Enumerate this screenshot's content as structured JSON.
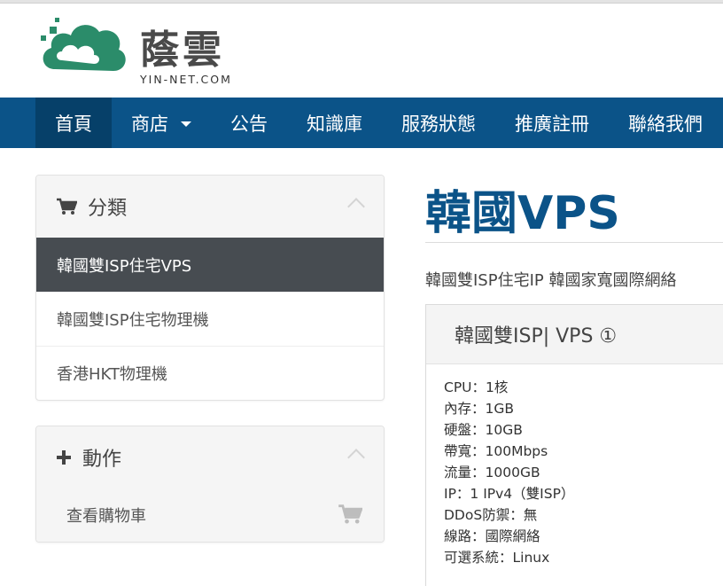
{
  "brand": {
    "name": "蔭雲",
    "sub": "YIN-NET.COM",
    "colors": {
      "logo_green": "#2b8c6a",
      "nav_blue": "#0b5388",
      "nav_active": "#064069"
    }
  },
  "nav": {
    "items": [
      {
        "label": "首頁",
        "active": true
      },
      {
        "label": "商店",
        "dropdown": true
      },
      {
        "label": "公告"
      },
      {
        "label": "知識庫"
      },
      {
        "label": "服務狀態"
      },
      {
        "label": "推廣註冊"
      },
      {
        "label": "聯絡我們"
      }
    ]
  },
  "sidebar": {
    "categories": {
      "title": "分類",
      "icon": "cart-icon",
      "items": [
        {
          "label": "韓國雙ISP住宅VPS",
          "active": true
        },
        {
          "label": "韓國雙ISP住宅物理機"
        },
        {
          "label": "香港HKT物理機"
        }
      ]
    },
    "actions": {
      "title": "動作",
      "icon": "plus-icon",
      "items": [
        {
          "label": "查看購物車",
          "icon": "cart-icon"
        }
      ]
    }
  },
  "main": {
    "title": "韓國VPS",
    "description": "韓國雙ISP住宅IP 韓國家寬國際網絡",
    "product": {
      "name": "韓國雙ISP| VPS ①",
      "specs": [
        "CPU：1核",
        "內存：1GB",
        "硬盤：10GB",
        "帶寬：100Mbps",
        "流量：1000GB",
        "IP：1 IPv4（雙ISP）",
        "DDoS防禦：無",
        "線路：國際網絡",
        "可選系統：Linux"
      ]
    }
  }
}
